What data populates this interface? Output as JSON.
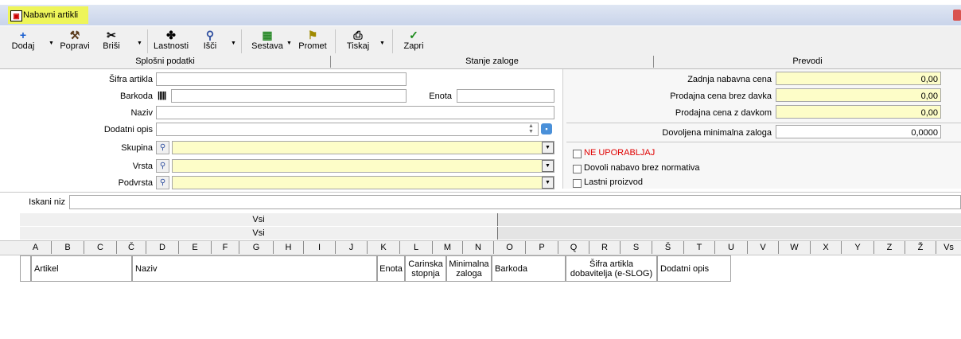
{
  "window": {
    "title": "Nabavni artikli"
  },
  "toolbar": {
    "add": "Dodaj",
    "edit": "Popravi",
    "delete": "Briši",
    "properties": "Lastnosti",
    "search": "Išči",
    "composition": "Sestava",
    "traffic": "Promet",
    "print": "Tiskaj",
    "close": "Zapri"
  },
  "tabs": [
    "Splošni podatki",
    "Stanje zaloge",
    "Prevodi"
  ],
  "form": {
    "sku_label": "Šifra artikla",
    "barcode_label": "Barkoda",
    "unit_label": "Enota",
    "name_label": "Naziv",
    "extra_desc_label": "Dodatni opis",
    "group_label": "Skupina",
    "type_label": "Vrsta",
    "subtype_label": "Podvrsta"
  },
  "prices": {
    "last_purchase_label": "Zadnja nabavna cena",
    "last_purchase_value": "0,00",
    "sale_no_tax_label": "Prodajna cena brez davka",
    "sale_no_tax_value": "0,00",
    "sale_tax_label": "Prodajna cena z davkom",
    "sale_tax_value": "0,00",
    "min_stock_label": "Dovoljena minimalna zaloga",
    "min_stock_value": "0,0000"
  },
  "checks": {
    "unused": "NE UPORABLJAJ",
    "allow_without_norm": "Dovoli nabavo brez normativa",
    "own_product": "Lastni proizvod"
  },
  "colors": {
    "warning": "#e00000",
    "highlight": "#fdfdc8",
    "title_highlight": "#eef55a"
  },
  "search": {
    "label": "Iskani niz"
  },
  "filters": {
    "row1": "Vsi",
    "row2": "Vsi"
  },
  "alphabet": [
    "A",
    "B",
    "C",
    "Č",
    "D",
    "E",
    "F",
    "G",
    "H",
    "I",
    "J",
    "K",
    "L",
    "M",
    "N",
    "O",
    "P",
    "Q",
    "R",
    "S",
    "Š",
    "T",
    "U",
    "V",
    "W",
    "X",
    "Y",
    "Z",
    "Ž",
    "Vs"
  ],
  "columns": {
    "article": "Artikel",
    "name": "Naziv",
    "unit": "Enota",
    "customs": "Carinska stopnja",
    "min_stock": "Minimalna zaloga",
    "barcode": "Barkoda",
    "supplier_sku": "Šifra artikla dobavitelja (e-SLOG)",
    "extra_desc": "Dodatni opis"
  }
}
